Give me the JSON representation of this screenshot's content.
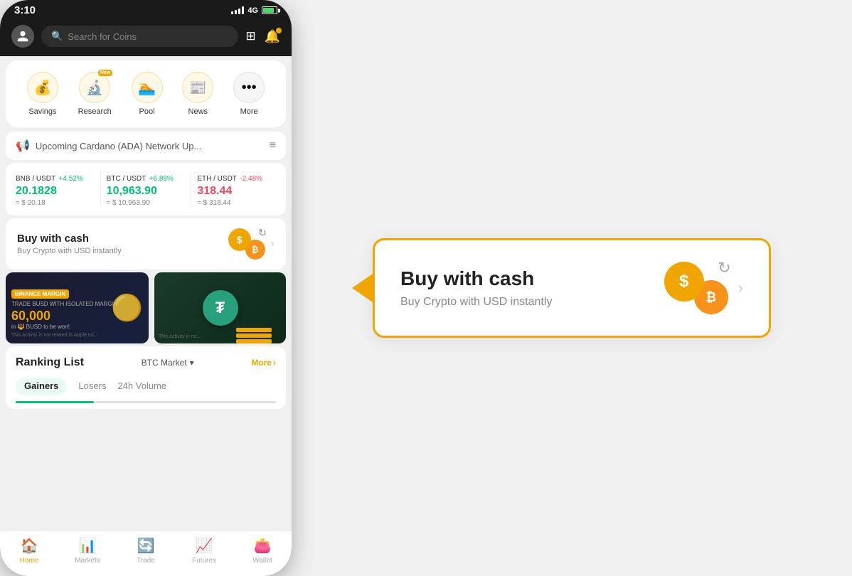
{
  "statusBar": {
    "time": "3:10",
    "network": "4G"
  },
  "topNav": {
    "searchPlaceholder": "Search for Coins"
  },
  "quickActions": [
    {
      "id": "savings",
      "label": "Savings",
      "icon": "💰",
      "isNew": false
    },
    {
      "id": "research",
      "label": "Research",
      "icon": "🔬",
      "isNew": true
    },
    {
      "id": "pool",
      "label": "Pool",
      "icon": "🏊",
      "isNew": false
    },
    {
      "id": "news",
      "label": "News",
      "icon": "📰",
      "isNew": false
    },
    {
      "id": "more",
      "label": "More",
      "icon": "⋯",
      "isNew": false
    }
  ],
  "announcement": {
    "text": "Upcoming Cardano (ADA) Network Up..."
  },
  "tickers": [
    {
      "pair": "BNB / USDT",
      "change": "+4.52%",
      "positive": true,
      "price": "20.1828",
      "usd": "≈ $ 20.18"
    },
    {
      "pair": "BTC / USDT",
      "change": "+6.89%",
      "positive": true,
      "price": "10,963.90",
      "usd": "≈ $ 10,963.90"
    },
    {
      "pair": "ETH / USDT",
      "change": "-2.48%",
      "positive": false,
      "price": "318.44",
      "usd": "≈ $ 318.44"
    }
  ],
  "buyCash": {
    "title": "Buy with cash",
    "subtitle": "Buy Crypto with USD instantly"
  },
  "banners": [
    {
      "type": "binance",
      "tag": "BINANCE MARGIN",
      "subtitle": "TRADE BUSD WITH ISOLATED MARGIN",
      "amount": "60,000",
      "unit": "in BUSD to be won!",
      "disclaimer": "This activity is not related to Apple Inc..."
    },
    {
      "type": "tether",
      "disclaimer": "This activity is no..."
    }
  ],
  "ranking": {
    "title": "Ranking List",
    "filter": "BTC Market",
    "moreLabel": "More",
    "tabs": [
      "Gainers",
      "Losers",
      "24h Volume"
    ],
    "activeTab": "Gainers"
  },
  "bottomNav": [
    {
      "id": "home",
      "label": "Home",
      "icon": "🏠",
      "active": true
    },
    {
      "id": "markets",
      "label": "Markets",
      "icon": "📊",
      "active": false
    },
    {
      "id": "trade",
      "label": "Trade",
      "icon": "🔄",
      "active": false
    },
    {
      "id": "futures",
      "label": "Futures",
      "icon": "📈",
      "active": false
    },
    {
      "id": "wallet",
      "label": "Wallet",
      "icon": "👛",
      "active": false
    }
  ],
  "zoomedCard": {
    "title": "Buy with cash",
    "subtitle": "Buy Crypto with USD instantly"
  },
  "newBadgeLabel": "New"
}
